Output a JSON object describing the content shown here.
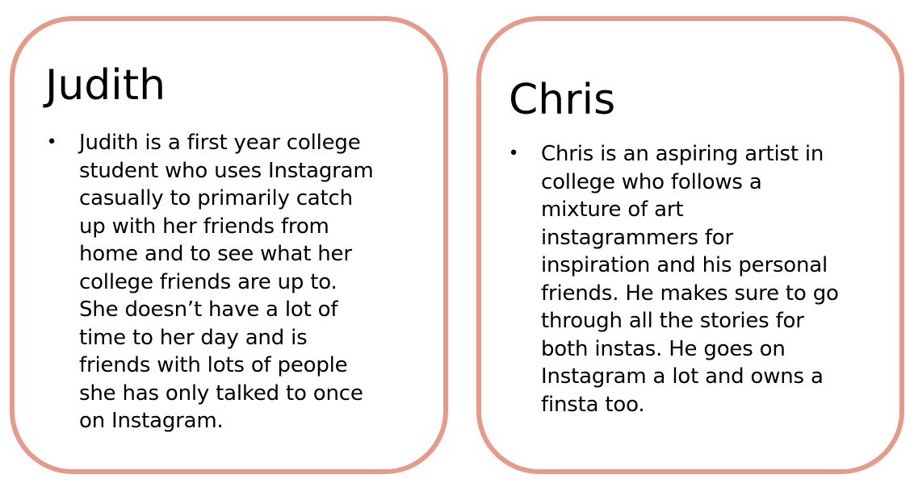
{
  "cards": [
    {
      "title": "Judith",
      "bullet": "•",
      "text": "Judith is a first year college\nstudent who uses Instagram\ncasually to primarily catch\nup with her friends from\nhome and to see what her\ncollege friends are up to.\nShe doesn’t have a lot of\ntime to her day and is\nfriends with lots of people\nshe has only talked to once\non Instagram."
    },
    {
      "title": "Chris",
      "bullet": "•",
      "text": "Chris is an aspiring artist in\ncollege who follows a\nmixture of art\ninstagrammers for\ninspiration and his personal\nfriends. He makes sure to go\nthrough all the stories for\nboth instas. He goes on\nInstagram a lot and owns a\nfinsta too."
    }
  ],
  "colors": {
    "card_border": "#e59a8a",
    "text": "#000000",
    "background": "#ffffff"
  }
}
